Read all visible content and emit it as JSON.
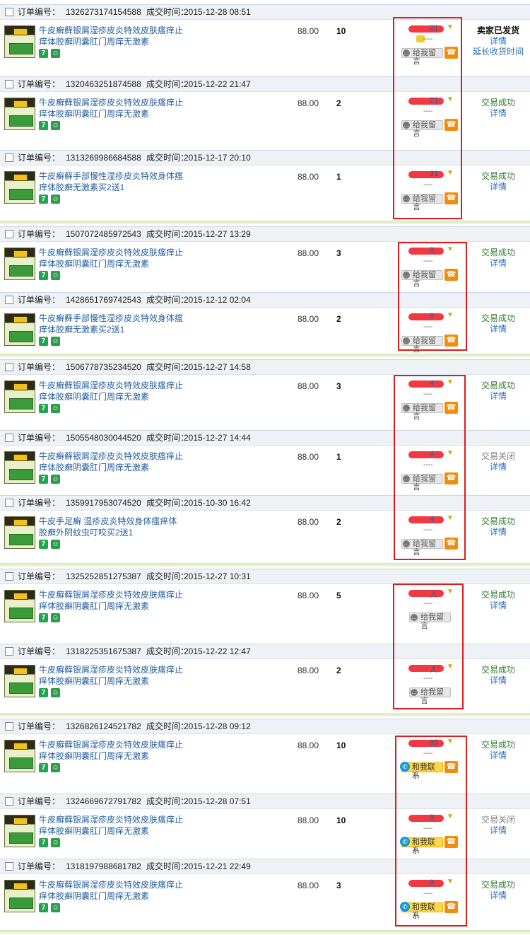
{
  "labels": {
    "order_no": "订单编号：",
    "deal_time": "成交时间：",
    "dash": "----",
    "message": "给我留言",
    "contact": "和我联系",
    "details": "详情",
    "extend": "延长收货时间"
  },
  "groups": [
    {
      "orders": [
        {
          "order_no": "1326273174154588",
          "time": "2015-12-28 08:51",
          "title": "牛皮癣藓银屑湿疹皮炎特效皮肤瘙痒止痒体胶癣阴囊肛门周痒无激素",
          "price": "88.00",
          "qty": "10",
          "buyer_tail": "21",
          "action": "message",
          "chat": true,
          "status": "卖家已发货",
          "status2": "详情",
          "status3": "延长收货时间",
          "style": "bold"
        },
        {
          "order_no": "1320463251874588",
          "time": "2015-12-22 21:47",
          "title": "牛皮癣藓银屑湿疹皮炎特效皮肤瘙痒止痒体胶癣阴囊肛门周痒无激素",
          "price": "88.00",
          "qty": "2",
          "buyer_tail": "21",
          "action": "message",
          "status": "交易成功",
          "status2": "详情",
          "style": "ok"
        },
        {
          "order_no": "1313269986684588",
          "time": "2015-12-17 20:10",
          "title": "牛皮癣藓手部慢性湿疹皮炎特效身体瘙痒体胶癣无激素买2送1",
          "price": "88.00",
          "qty": "1",
          "buyer_tail": "21",
          "action": "message",
          "status": "交易成功",
          "status2": "详情",
          "style": "ok"
        }
      ]
    },
    {
      "orders": [
        {
          "order_no": "1507072485972543",
          "time": "2015-12-27 13:29",
          "title": "牛皮癣藓银屑湿疹皮炎特效皮肤瘙痒止痒体胶癣阴囊肛门周痒无激素",
          "price": "88.00",
          "qty": "3",
          "buyer_tail": "8",
          "action": "message",
          "status": "交易成功",
          "status2": "详情",
          "style": "ok"
        },
        {
          "order_no": "1428651769742543",
          "time": "2015-12-12 02:04",
          "title": "牛皮癣藓手部慢性湿疹皮炎特效身体瘙痒体胶癣无激素买2送1",
          "price": "88.00",
          "qty": "2",
          "buyer_tail": "8",
          "action": "message",
          "status": "交易成功",
          "status2": "详情",
          "style": "ok"
        }
      ]
    },
    {
      "orders": [
        {
          "order_no": "1506778735234520",
          "time": "2015-12-27 14:58",
          "title": "牛皮癣藓银屑湿疹皮炎特效皮肤瘙痒止痒体胶癣阴囊肛门周痒无激素",
          "price": "88.00",
          "qty": "3",
          "buyer_tail": "4",
          "action": "message",
          "status": "交易成功",
          "status2": "详情",
          "style": "ok"
        },
        {
          "order_no": "1505548030044520",
          "time": "2015-12-27 14:44",
          "title": "牛皮癣藓银屑湿疹皮炎特效皮肤瘙痒止痒体胶癣阴囊肛门周痒无激素",
          "price": "88.00",
          "qty": "1",
          "buyer_tail": "4",
          "action": "message",
          "status": "交易关闭",
          "status2": "详情",
          "style": "gray"
        },
        {
          "order_no": "1359917953074520",
          "time": "2015-10-30 16:42",
          "title": "牛皮手足癣 湿疹皮炎特效身体瘙痒体胶癣外阴蚊虫叮咬买2送1",
          "price": "88.00",
          "qty": "2",
          "buyer_tail": "4",
          "action": "message",
          "status": "交易成功",
          "status2": "详情",
          "style": "ok"
        }
      ]
    },
    {
      "orders": [
        {
          "order_no": "1325252851275387",
          "time": "2015-12-27 10:31",
          "title": "牛皮癣藓银屑湿疹皮炎特效皮肤瘙痒止痒体胶癣阴囊肛门周痒无激素",
          "price": "88.00",
          "qty": "5",
          "buyer_tail": "人",
          "action": "message_only",
          "status": "交易成功",
          "status2": "详情",
          "style": "ok"
        },
        {
          "order_no": "1318225351675387",
          "time": "2015-12-22 12:47",
          "title": "牛皮癣藓银屑湿疹皮炎特效皮肤瘙痒止痒体胶癣阴囊肛门周痒无激素",
          "price": "88.00",
          "qty": "2",
          "buyer_tail": "人",
          "action": "message_only",
          "status": "交易成功",
          "status2": "详情",
          "style": "ok"
        }
      ]
    },
    {
      "orders": [
        {
          "order_no": "1326826124521782",
          "time": "2015-12-28 09:12",
          "title": "牛皮癣藓银屑湿疹皮炎特效皮肤瘙痒止痒体胶癣阴囊肛门周痒无激素",
          "price": "88.00",
          "qty": "10",
          "buyer_tail": "99",
          "action": "contact",
          "status": "交易成功",
          "status2": "详情",
          "style": "ok"
        },
        {
          "order_no": "1324669672791782",
          "time": "2015-12-28 07:51",
          "title": "牛皮癣藓银屑湿疹皮炎特效皮肤瘙痒止痒体胶癣阴囊肛门周痒无激素",
          "price": "88.00",
          "qty": "10",
          "buyer_tail": "9",
          "action": "contact",
          "status": "交易关闭",
          "status2": "详情",
          "style": "gray"
        },
        {
          "order_no": "1318197988681782",
          "time": "2015-12-21 22:49",
          "title": "牛皮癣藓银屑湿疹皮炎特效皮肤瘙痒止痒体胶癣阴囊肛门周痒无激素",
          "price": "88.00",
          "qty": "3",
          "buyer_tail": "9",
          "action": "contact",
          "status": "交易成功",
          "status2": "详情",
          "style": "ok"
        }
      ]
    }
  ]
}
